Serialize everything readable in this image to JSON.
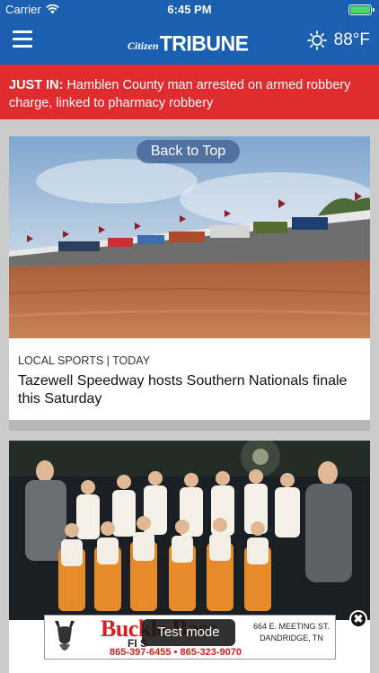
{
  "status_bar": {
    "carrier": "Carrier",
    "time": "6:45 PM",
    "battery_level": 1.0
  },
  "nav": {
    "logo_prefix": "Citizen",
    "logo_main": "TRIBUNE",
    "weather_icon": "sun-icon",
    "temperature": "88°F"
  },
  "breaking": {
    "tag": "JUST IN:",
    "text": "Hamblen County man arrested on armed robbery charge, linked to pharmacy robbery"
  },
  "back_to_top": "Back to Top",
  "articles": [
    {
      "section": "LOCAL SPORTS | TODAY",
      "title": "Tazewell Speedway hosts Southern Nationals finale this Saturday"
    }
  ],
  "ad": {
    "brand": "Buckle Bass",
    "sub": "FI          S",
    "phones": "865-397-6455 • 865-323-9070",
    "address_line1": "664 E. MEETING ST.",
    "address_line2": "DANDRIDGE, TN",
    "test_mode_label": "Test mode",
    "close_label": "✖"
  },
  "colors": {
    "brand_blue": "#1b5fb0",
    "breaking_red": "#e02b2f"
  }
}
